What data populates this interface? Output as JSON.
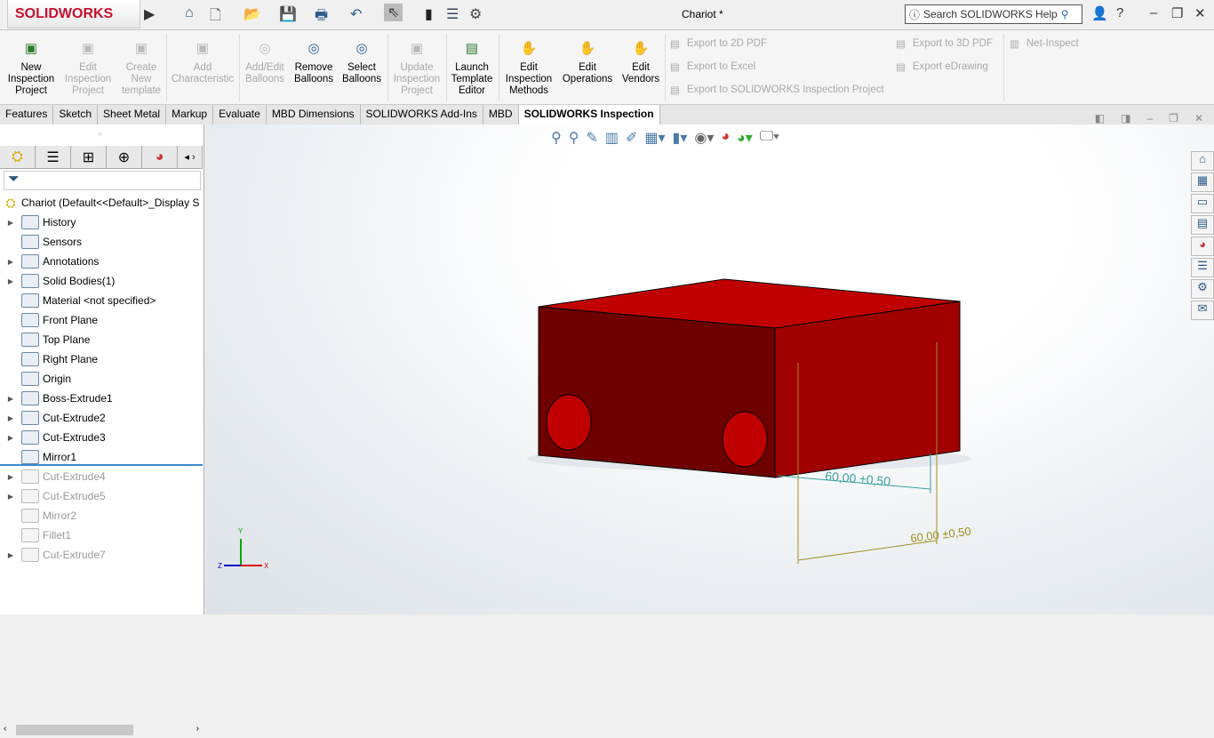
{
  "app": {
    "logo": "SOLIDWORKS",
    "title": "Chariot *",
    "search_placeholder": "Search SOLIDWORKS Help"
  },
  "quick_access": [
    "home-icon",
    "new-icon",
    "open-icon",
    "save-icon",
    "print-icon",
    "undo-icon",
    "select-icon",
    "rebuild-icon",
    "file-properties-icon",
    "options-icon"
  ],
  "ribbon": {
    "buttons": [
      {
        "label": "New Inspection Project",
        "enabled": true
      },
      {
        "label": "Edit Inspection Project",
        "enabled": false
      },
      {
        "label": "Create New template",
        "enabled": false
      },
      {
        "label": "Add Characteristic",
        "enabled": false
      },
      {
        "label": "Add/Edit Balloons",
        "enabled": false
      },
      {
        "label": "Remove Balloons",
        "enabled": true
      },
      {
        "label": "Select Balloons",
        "enabled": true
      },
      {
        "label": "Update Inspection Project",
        "enabled": false
      },
      {
        "label": "Launch Template Editor",
        "enabled": true
      },
      {
        "label": "Edit Inspection Methods",
        "enabled": true
      },
      {
        "label": "Edit Operations",
        "enabled": true
      },
      {
        "label": "Edit Vendors",
        "enabled": true
      }
    ],
    "small": [
      "Export to 2D PDF",
      "Export to Excel",
      "Export to SOLIDWORKS Inspection Project",
      "Export to 3D PDF",
      "Export eDrawing",
      "Net-Inspect"
    ]
  },
  "tabs": [
    "Features",
    "Sketch",
    "Sheet Metal",
    "Markup",
    "Evaluate",
    "MBD Dimensions",
    "SOLIDWORKS Add-Ins",
    "MBD",
    "SOLIDWORKS Inspection"
  ],
  "active_tab": "SOLIDWORKS Inspection",
  "tree": {
    "root": "Chariot  (Default<<Default>_Display S",
    "items": [
      {
        "label": "History",
        "arrow": true
      },
      {
        "label": "Sensors",
        "arrow": false
      },
      {
        "label": "Annotations",
        "arrow": true
      },
      {
        "label": "Solid Bodies(1)",
        "arrow": true
      },
      {
        "label": "Material <not specified>",
        "arrow": false
      },
      {
        "label": "Front Plane",
        "arrow": false
      },
      {
        "label": "Top Plane",
        "arrow": false
      },
      {
        "label": "Right Plane",
        "arrow": false
      },
      {
        "label": "Origin",
        "arrow": false
      },
      {
        "label": "Boss-Extrude1",
        "arrow": true
      },
      {
        "label": "Cut-Extrude2",
        "arrow": true
      },
      {
        "label": "Cut-Extrude3",
        "arrow": true
      },
      {
        "label": "Mirror1",
        "arrow": false
      },
      {
        "label": "Cut-Extrude4",
        "arrow": true,
        "suppressed": true
      },
      {
        "label": "Cut-Extrude5",
        "arrow": true,
        "suppressed": true
      },
      {
        "label": "Mirror2",
        "arrow": false,
        "suppressed": true
      },
      {
        "label": "Fillet1",
        "arrow": false,
        "suppressed": true
      },
      {
        "label": "Cut-Extrude7",
        "arrow": true,
        "suppressed": true
      }
    ]
  },
  "model": {
    "dim1": "60,00 ±0,50",
    "dim2": "60,00 ±0,50",
    "color": "#c00000",
    "axes": {
      "x": "X",
      "y": "Y",
      "z": "Z"
    }
  }
}
